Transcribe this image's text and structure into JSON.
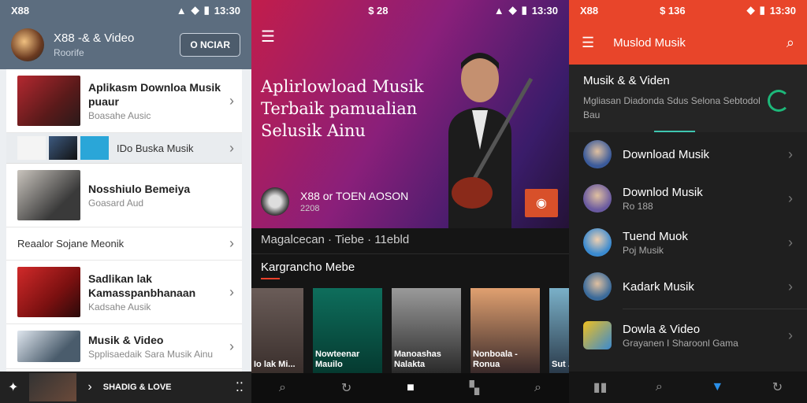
{
  "left": {
    "status": {
      "carrier": "X88",
      "time": "13:30"
    },
    "header": {
      "title": "X88 -& & Video",
      "subtitle": "Roorife",
      "button": "O NCIAR"
    },
    "items": [
      {
        "title": "Aplikasm Downloa Musik puaur",
        "subtitle": "Boasahe Ausic"
      },
      {
        "title": "Nosshiulo Bemeiya",
        "subtitle": "Goasard Aud"
      },
      {
        "title": "Sadlikan lak Kamasspanbhanaan",
        "subtitle": "Kadsahe Ausik"
      },
      {
        "title": "Musik & Video",
        "subtitle": "Spplisaedaik Sara Musik Ainu"
      }
    ],
    "small_item": {
      "label": "IDo Buska Musik"
    },
    "plain_item": {
      "label": "Reaalor Sojane Meonik"
    },
    "bottom": {
      "brand": "SHADIG & LOVE"
    }
  },
  "center": {
    "status": {
      "center": "$ 28",
      "time": "13:30"
    },
    "headline": "Aplirlowload Musik Terbaik pamualian Selusik Ainu",
    "artist": {
      "name": "X88 or TOEN AOSON",
      "year": "2208"
    },
    "caption": "Magalcecan · Tiebe · 11ebld",
    "section": "Kargrancho Mebe",
    "cards": [
      {
        "label": "Io lak Mi..."
      },
      {
        "label": "Nowteenar Mauilo"
      },
      {
        "label": "Manoashas Nalakta"
      },
      {
        "label": "Nonboala - Ronua"
      },
      {
        "label": "Sut ..."
      }
    ]
  },
  "right": {
    "status": {
      "carrier": "X88",
      "center": "$ 136",
      "time": "13:30"
    },
    "appbar": {
      "title": "Muslod Musik"
    },
    "head": {
      "title": "Musik & & Viden",
      "subtitle": "Mgliasan Diadonda Sdus Selona Sebtodol Bau"
    },
    "items": [
      {
        "title": "Download Musik",
        "subtitle": ""
      },
      {
        "title": "Downlod Musik",
        "subtitle": "Ro 188"
      },
      {
        "title": "Tuend Muok",
        "subtitle": "Poj Musik"
      },
      {
        "title": "Kadark Musik",
        "subtitle": ""
      },
      {
        "title": "Dowla & Video",
        "subtitle": "Grayanen I Sharoonl Gama"
      }
    ]
  }
}
